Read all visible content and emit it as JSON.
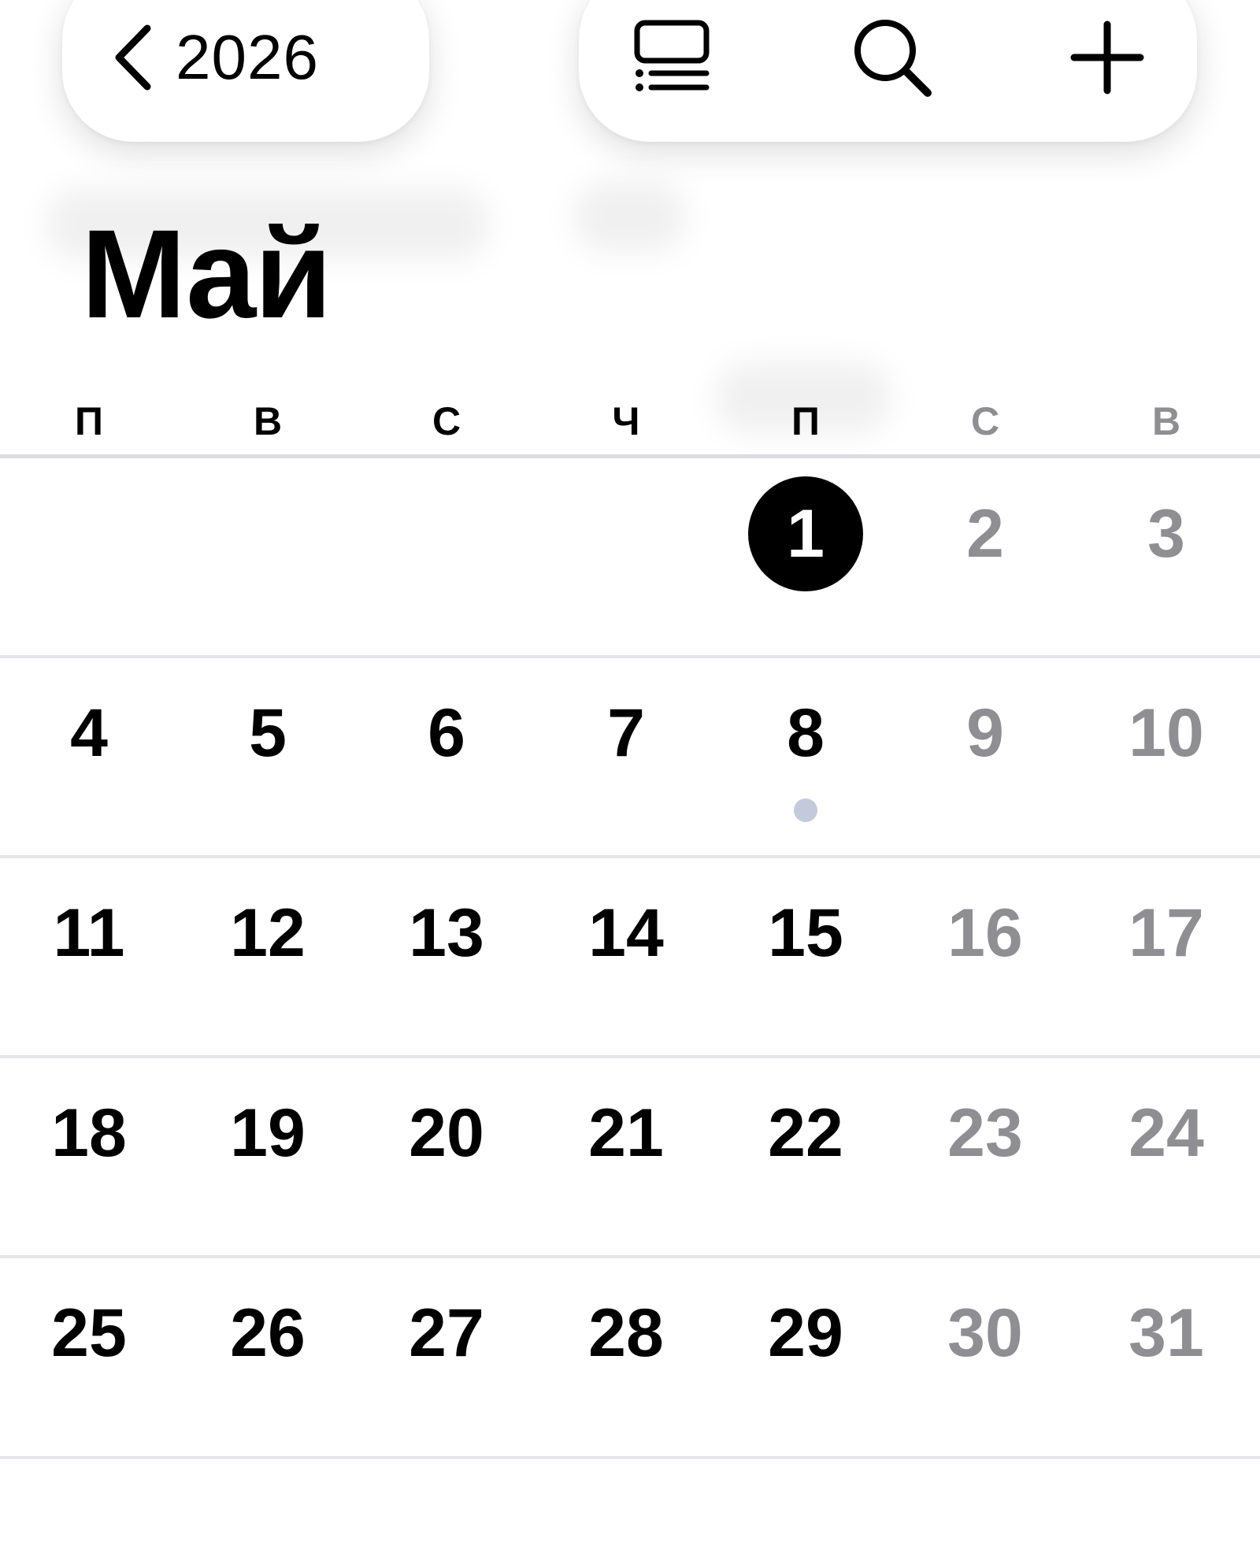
{
  "toolbar": {
    "back_label": "2026",
    "back_icon": "chevron-left-icon",
    "list_view_icon": "list-view-icon",
    "search_icon": "search-icon",
    "add_icon": "plus-icon"
  },
  "month": {
    "title": "Май"
  },
  "weekdays": [
    {
      "label": "П",
      "weekend": false
    },
    {
      "label": "В",
      "weekend": false
    },
    {
      "label": "С",
      "weekend": false
    },
    {
      "label": "Ч",
      "weekend": false
    },
    {
      "label": "П",
      "weekend": false
    },
    {
      "label": "С",
      "weekend": true
    },
    {
      "label": "В",
      "weekend": true
    }
  ],
  "weeks": [
    [
      {
        "day": ""
      },
      {
        "day": ""
      },
      {
        "day": ""
      },
      {
        "day": ""
      },
      {
        "day": "1",
        "today": true
      },
      {
        "day": "2",
        "weekend": true
      },
      {
        "day": "3",
        "weekend": true
      }
    ],
    [
      {
        "day": "4"
      },
      {
        "day": "5"
      },
      {
        "day": "6"
      },
      {
        "day": "7"
      },
      {
        "day": "8",
        "has_event": true
      },
      {
        "day": "9",
        "weekend": true
      },
      {
        "day": "10",
        "weekend": true
      }
    ],
    [
      {
        "day": "11"
      },
      {
        "day": "12"
      },
      {
        "day": "13"
      },
      {
        "day": "14"
      },
      {
        "day": "15"
      },
      {
        "day": "16",
        "weekend": true
      },
      {
        "day": "17",
        "weekend": true
      }
    ],
    [
      {
        "day": "18"
      },
      {
        "day": "19"
      },
      {
        "day": "20"
      },
      {
        "day": "21"
      },
      {
        "day": "22"
      },
      {
        "day": "23",
        "weekend": true
      },
      {
        "day": "24",
        "weekend": true
      }
    ],
    [
      {
        "day": "25"
      },
      {
        "day": "26"
      },
      {
        "day": "27"
      },
      {
        "day": "28"
      },
      {
        "day": "29"
      },
      {
        "day": "30",
        "weekend": true
      },
      {
        "day": "31",
        "weekend": true
      }
    ]
  ],
  "colors": {
    "weekend_text": "#8e8e93",
    "today_circle": "#000000",
    "event_dot": "#c3cadb",
    "separator": "#e5e5ea"
  }
}
